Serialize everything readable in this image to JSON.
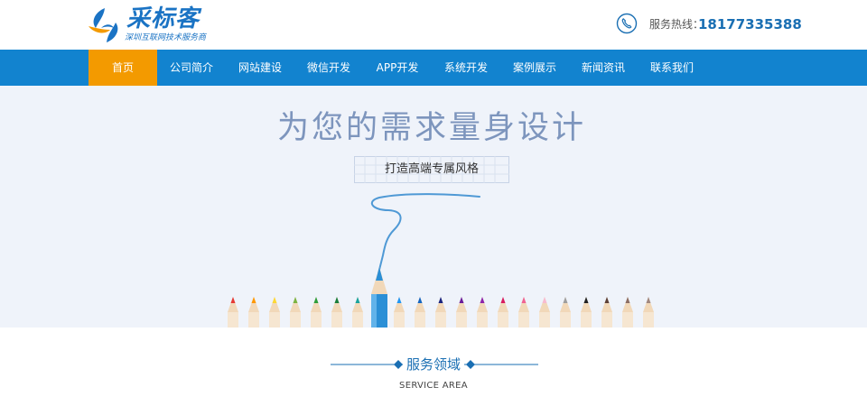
{
  "header": {
    "logo": {
      "name": "采标客",
      "tagline": "深圳互联网技术服务商",
      "mark_icon": "swirl-leaf-logo-icon",
      "colors": {
        "blue": "#1a73c4",
        "orange": "#f39a00"
      }
    },
    "hotline": {
      "icon": "phone-icon",
      "label": "服务热线：",
      "number": "18177335388"
    }
  },
  "nav": {
    "background": "#1283cf",
    "active_color": "#f39a00",
    "items": [
      {
        "label": "首页",
        "active": true
      },
      {
        "label": "公司简介",
        "active": false
      },
      {
        "label": "网站建设",
        "active": false
      },
      {
        "label": "微信开发",
        "active": false
      },
      {
        "label": "APP开发",
        "active": false
      },
      {
        "label": "系统开发",
        "active": false
      },
      {
        "label": "案例展示",
        "active": false
      },
      {
        "label": "新闻资讯",
        "active": false
      },
      {
        "label": "联系我们",
        "active": false
      }
    ]
  },
  "banner": {
    "title": "为您的需求量身设计",
    "subtitle": "打造高端专属风格",
    "background": "#eff3fa",
    "pencil_colors": [
      "#e53935",
      "#ff9800",
      "#fdd835",
      "#7cb342",
      "#2e9d3a",
      "#1b7d3a",
      "#1ba39c",
      "#2196f3",
      "#1565c0",
      "#1a237e",
      "#6a1b9a",
      "#8e24aa",
      "#d81b60",
      "#f06292",
      "#f8bbd0",
      "#9e9e9e",
      "#212121",
      "#5d4037",
      "#8d6e63",
      "#a1887f"
    ]
  },
  "service": {
    "title": "服务领域",
    "subtitle": "SERVICE AREA"
  }
}
